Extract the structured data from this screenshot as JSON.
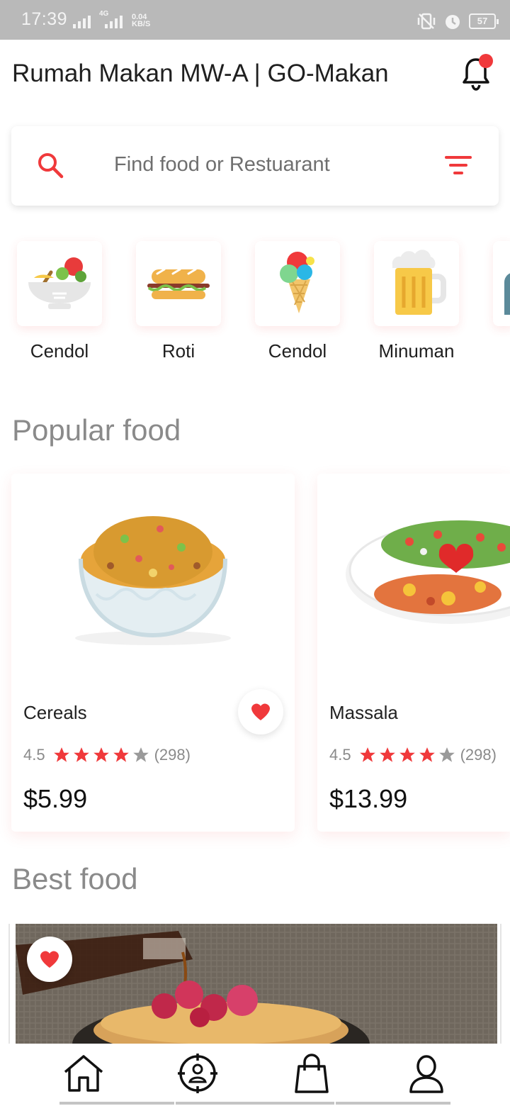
{
  "status_bar": {
    "time": "17:39",
    "network": "4G",
    "speed_value": "0.04",
    "speed_unit": "KB/S",
    "battery": "57"
  },
  "header": {
    "title": "Rumah Makan MW-A | GO-Makan",
    "notification_icon": "bell-icon",
    "has_notification": true
  },
  "search": {
    "placeholder": "Find food or Restuarant",
    "icon": "search-icon",
    "filter_icon": "filter-icon"
  },
  "categories": [
    {
      "label": "Cendol",
      "icon": "salad-bowl-icon"
    },
    {
      "label": "Roti",
      "icon": "sandwich-icon"
    },
    {
      "label": "Cendol",
      "icon": "ice-cream-icon"
    },
    {
      "label": "Minuman",
      "icon": "beer-mug-icon"
    }
  ],
  "popular": {
    "title": "Popular food",
    "items": [
      {
        "name": "Cereals",
        "rating": "4.5",
        "stars": 4,
        "reviews": "(298)",
        "price": "$5.99",
        "favorite": true
      },
      {
        "name": "Massala",
        "rating": "4.5",
        "stars": 4,
        "reviews": "(298)",
        "price": "$13.99",
        "favorite": false
      }
    ]
  },
  "best": {
    "title": "Best food"
  },
  "bottom_nav": [
    {
      "icon": "home-icon"
    },
    {
      "icon": "explore-icon"
    },
    {
      "icon": "shopping-bag-icon"
    },
    {
      "icon": "profile-icon"
    }
  ],
  "colors": {
    "accent": "#f0393b",
    "star_off": "#9a9a9a"
  }
}
